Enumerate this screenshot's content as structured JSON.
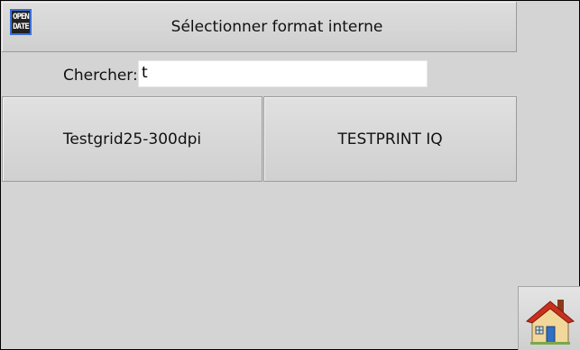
{
  "header": {
    "logo_text_line1": "OPEN",
    "logo_text_line2": "DATE",
    "title": "Sélectionner format interne"
  },
  "search": {
    "label": "Chercher:",
    "value": "t"
  },
  "results": [
    {
      "label": "Testgrid25-300dpi"
    },
    {
      "label": "TESTPRINT IQ"
    }
  ],
  "home_button": {
    "icon": "home-icon"
  }
}
